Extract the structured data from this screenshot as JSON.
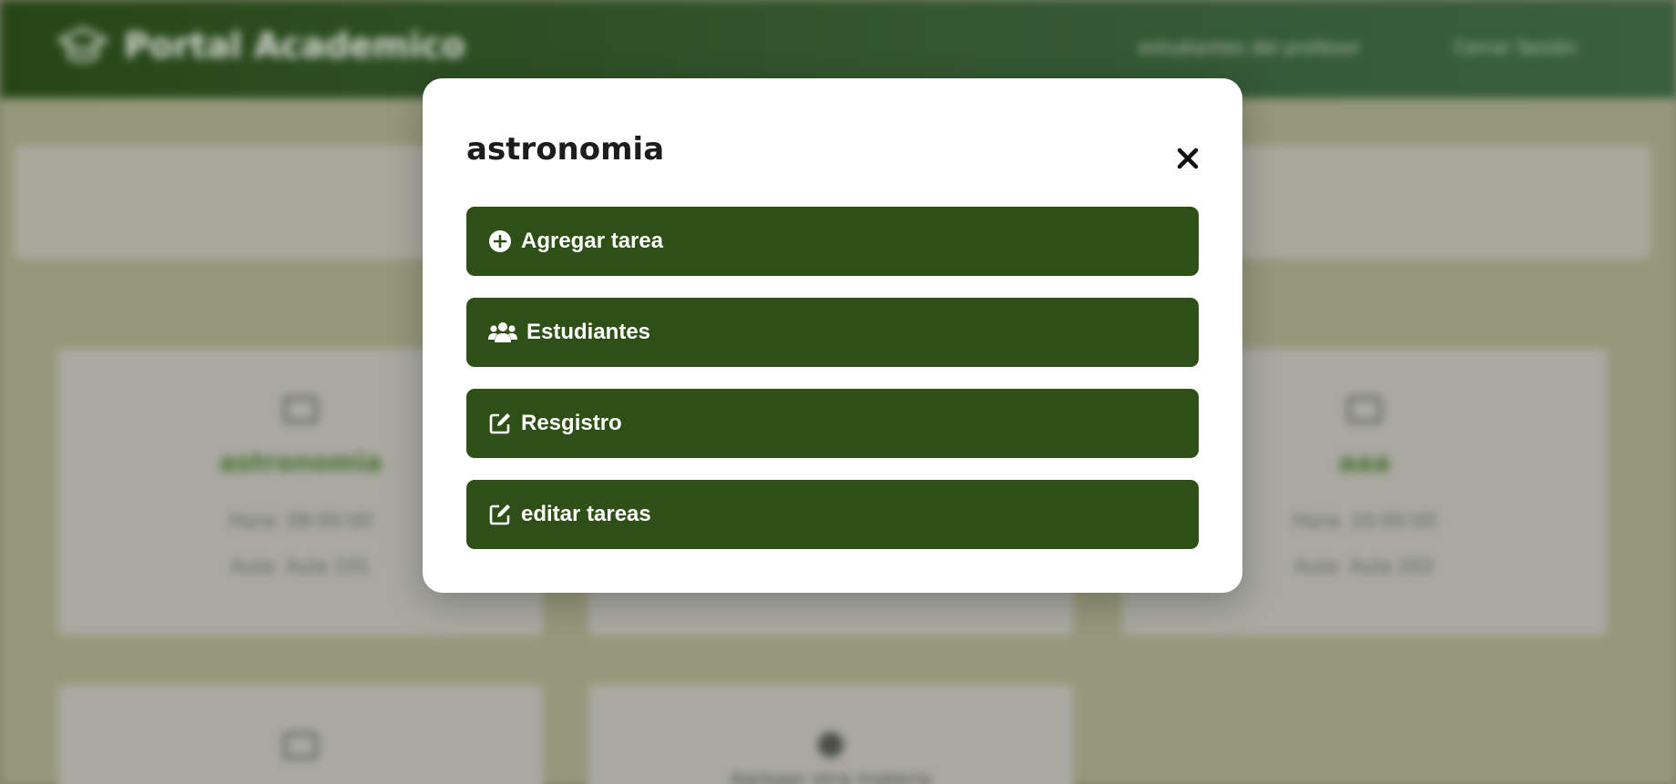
{
  "header": {
    "brand": "Portal Academico",
    "nav": [
      "estudiantes del profesor",
      "Cerrar Sesión"
    ]
  },
  "cards": [
    {
      "title": "astronomia",
      "hora": "Hora: 08:00:00",
      "aula": "Aula: Aula 101"
    },
    {
      "title": "aaa",
      "hora": "Hora: 10:00:00",
      "aula": "Aula: Aula 202"
    }
  ],
  "add_card": {
    "label": "Agregar otra materia"
  },
  "modal": {
    "title": "astronomia",
    "close_icon": "close-icon",
    "actions": [
      {
        "label": "Agregar tarea",
        "icon": "plus-circle-icon"
      },
      {
        "label": "Estudiantes",
        "icon": "users-icon"
      },
      {
        "label": "Resgistro",
        "icon": "edit-icon"
      },
      {
        "label": "editar tareas",
        "icon": "edit-icon"
      }
    ]
  },
  "colors": {
    "primary_green": "#2e5017",
    "header_green": "#2c4f1a",
    "modal_bg": "#ffffff"
  }
}
